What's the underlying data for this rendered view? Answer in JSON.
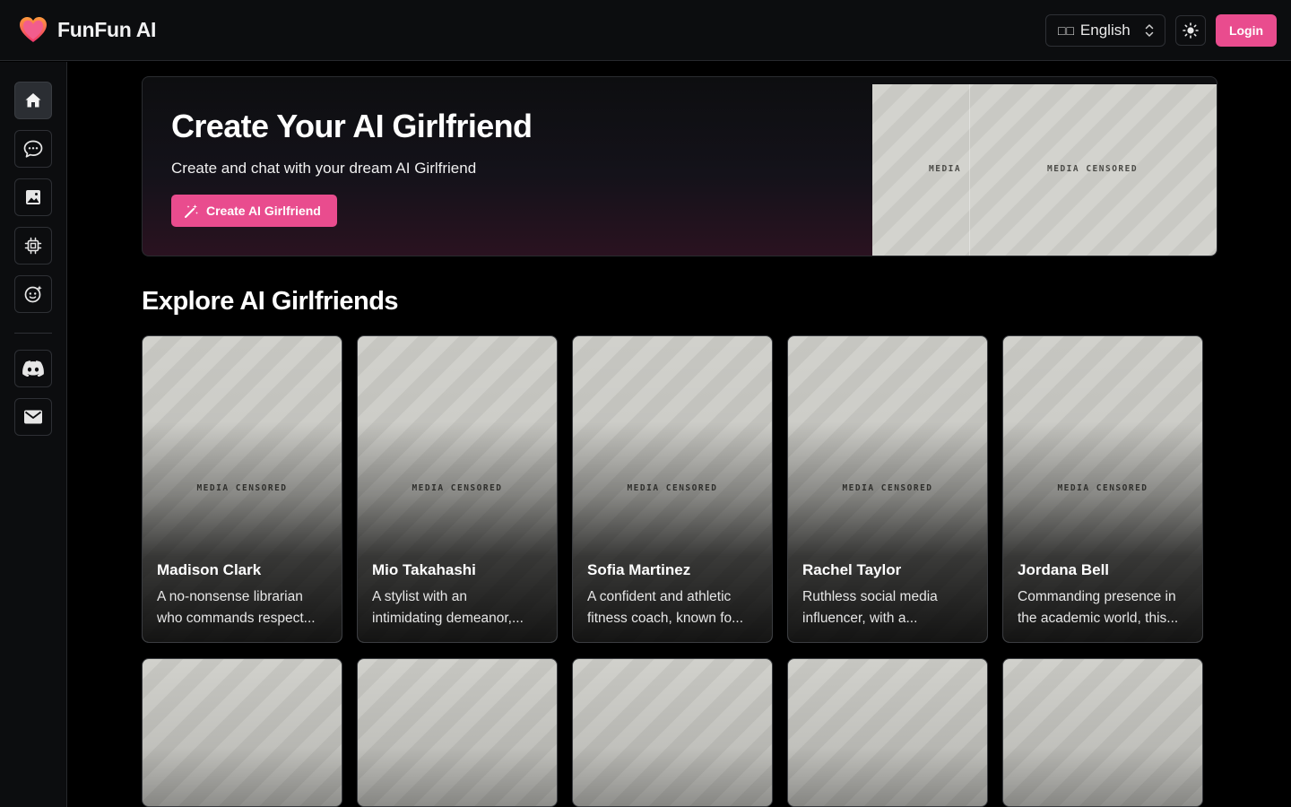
{
  "header": {
    "brand_name": "FunFun AI",
    "language_flag": "□□",
    "language_label": "English",
    "login_label": "Login"
  },
  "sidebar": {
    "items": [
      {
        "icon": "home-icon",
        "active": true
      },
      {
        "icon": "chat-icon",
        "active": false
      },
      {
        "icon": "image-icon",
        "active": false
      },
      {
        "icon": "chip-icon",
        "active": false
      },
      {
        "icon": "face-icon",
        "active": false
      },
      {
        "icon": "discord-icon",
        "active": false
      },
      {
        "icon": "mail-icon",
        "active": false
      }
    ]
  },
  "hero": {
    "title": "Create Your AI Girlfriend",
    "subtitle": "Create and chat with your dream AI Girlfriend",
    "cta_label": "Create AI Girlfriend",
    "media_label_left": "MEDIA",
    "media_label_right": "MEDIA CENSORED"
  },
  "explore": {
    "title": "Explore AI Girlfriends",
    "censor_label": "MEDIA CENSORED",
    "cards": [
      {
        "name": "Madison Clark",
        "desc_line1": "A no-nonsense librarian",
        "desc_line2": "who commands respect..."
      },
      {
        "name": "Mio Takahashi",
        "desc_line1": "A stylist with an",
        "desc_line2": "intimidating demeanor,..."
      },
      {
        "name": "Sofia Martinez",
        "desc_line1": "A confident and athletic",
        "desc_line2": "fitness coach, known fo..."
      },
      {
        "name": "Rachel Taylor",
        "desc_line1": "Ruthless social media",
        "desc_line2": "influencer, with a..."
      },
      {
        "name": "Jordana Bell",
        "desc_line1": "Commanding presence in",
        "desc_line2": "the academic world, this..."
      }
    ]
  },
  "colors": {
    "accent": "#e94c8e",
    "background": "#000000",
    "panel": "#0c0d0f",
    "border": "#2e3035"
  }
}
